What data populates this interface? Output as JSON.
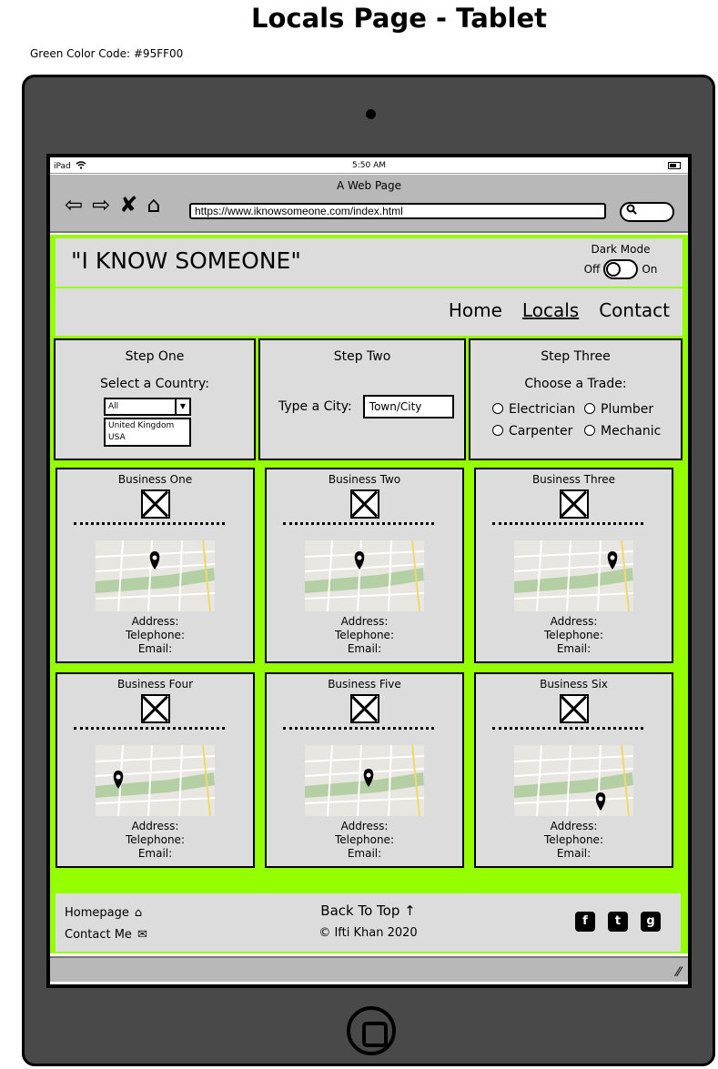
{
  "page": {
    "title": "Locals Page - Tablet",
    "color_note": "Green Color Code: #95FF00"
  },
  "colors": {
    "accent_green": "#95FF00",
    "panel_gray": "#dcdcdc",
    "device_gray": "#494949"
  },
  "status_bar": {
    "device": "iPad",
    "wifi_icon": "wifi-icon",
    "time": "5:50 AM",
    "battery_icon": "battery-icon"
  },
  "browser": {
    "title": "A Web Page",
    "url": "https://www.iknowsomeone.com/index.html",
    "search_icon": "search-icon"
  },
  "site": {
    "logo": "\"I KNOW SOMEONE\"",
    "dark_mode": {
      "label": "Dark Mode",
      "off": "Off",
      "on": "On"
    },
    "nav": [
      {
        "label": "Home"
      },
      {
        "label": "Locals"
      },
      {
        "label": "Contact"
      }
    ],
    "filters": {
      "step_one": {
        "title": "Step One",
        "label": "Select a Country:",
        "selected": "All",
        "options": [
          "United Kingdom",
          "USA"
        ]
      },
      "step_two": {
        "title": "Step Two",
        "label": "Type a City:",
        "placeholder": "Town/City"
      },
      "step_three": {
        "title": "Step Three",
        "label": "Choose a Trade:",
        "trades": [
          "Electrician",
          "Plumber",
          "Carpenter",
          "Mechanic"
        ]
      }
    },
    "businesses": [
      {
        "name": "Business One",
        "address": "Address:",
        "telephone": "Telephone:",
        "email": "Email:"
      },
      {
        "name": "Business Two",
        "address": "Address:",
        "telephone": "Telephone:",
        "email": "Email:"
      },
      {
        "name": "Business Three",
        "address": "Address:",
        "telephone": "Telephone:",
        "email": "Email:"
      },
      {
        "name": "Business Four",
        "address": "Address:",
        "telephone": "Telephone:",
        "email": "Email:"
      },
      {
        "name": "Business Five",
        "address": "Address:",
        "telephone": "Telephone:",
        "email": "Email:"
      },
      {
        "name": "Business Six",
        "address": "Address:",
        "telephone": "Telephone:",
        "email": "Email:"
      }
    ],
    "footer": {
      "homepage": "Homepage",
      "contact": "Contact Me",
      "back_to_top": "Back To Top",
      "copyright": "Ifti Khan 2020",
      "socials": [
        "facebook-icon",
        "twitter-icon",
        "github-icon"
      ]
    }
  }
}
